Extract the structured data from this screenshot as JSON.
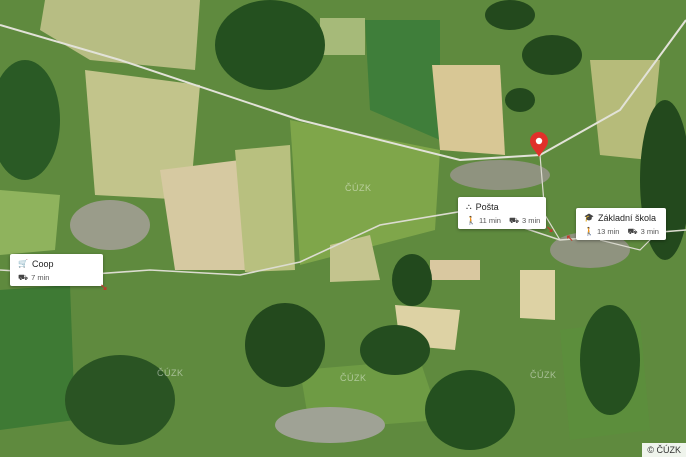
{
  "pois": [
    {
      "name": "Coop",
      "icon": "cart-icon",
      "walk": null,
      "drive": "7 min"
    },
    {
      "name": "Pošta",
      "icon": "post-icon",
      "walk": "11 min",
      "drive": "3 min"
    },
    {
      "name": "Základní škola Šu...",
      "icon": "school-icon",
      "walk": "13 min",
      "drive": "3 min"
    }
  ],
  "watermark": "ČÚZK",
  "copyright": "© ČÚZK",
  "colors": {
    "pin": "#e0302a",
    "card": "#ffffff"
  }
}
